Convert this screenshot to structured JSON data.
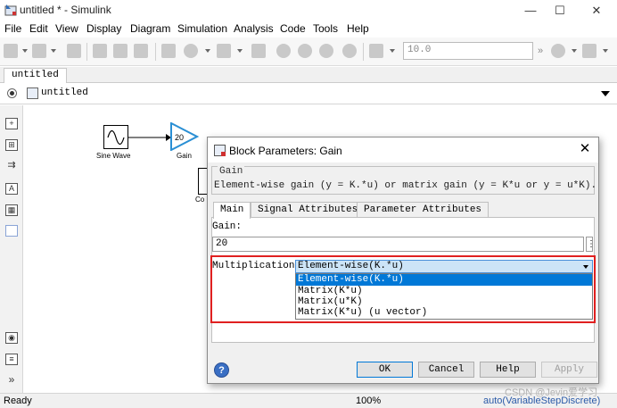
{
  "window": {
    "title": "untitled * - Simulink",
    "controls": {
      "minimize": "—",
      "maximize": "☐",
      "close": "✕"
    }
  },
  "menu": [
    "File",
    "Edit",
    "View",
    "Display",
    "Diagram",
    "Simulation",
    "Analysis",
    "Code",
    "Tools",
    "Help"
  ],
  "toolbar": {
    "stop_time": "10.0"
  },
  "model_tab": "untitled",
  "address": {
    "path": "untitled"
  },
  "canvas": {
    "blocks": [
      {
        "label": "Sine Wave"
      },
      {
        "label": "Gain",
        "value": "20"
      },
      {
        "label": "Co"
      }
    ]
  },
  "status": {
    "ready": "Ready",
    "zoom": "100%",
    "solver": "auto(VariableStepDiscrete)"
  },
  "dialog": {
    "title": "Block Parameters: Gain",
    "close": "✕",
    "group_title": "Gain",
    "description": "Element-wise gain (y = K.*u) or matrix gain (y = K*u or y = u*K).",
    "tabs": [
      "Main",
      "Signal Attributes",
      "Parameter Attributes"
    ],
    "gain_label": "Gain:",
    "gain_value": "20",
    "more_button": "⋮",
    "multiplication_label": "Multiplication:",
    "multiplication_selected": "Element-wise(K.*u)",
    "multiplication_options": [
      "Element-wise(K.*u)",
      "Matrix(K*u)",
      "Matrix(u*K)",
      "Matrix(K*u) (u vector)"
    ],
    "help_icon": "?",
    "buttons": {
      "ok": "OK",
      "cancel": "Cancel",
      "help": "Help",
      "apply": "Apply"
    }
  },
  "watermark": "CSDN @Jevin爱学习",
  "colors": {
    "highlight": "#e02020",
    "selection": "#0078d7",
    "gain_block": "#2a8fd4"
  }
}
